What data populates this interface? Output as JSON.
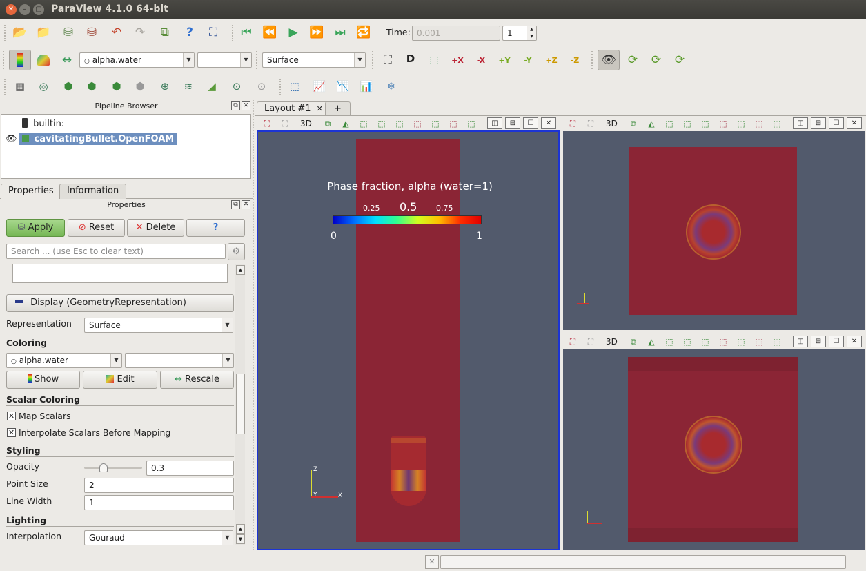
{
  "window": {
    "title": "ParaView 4.1.0 64-bit"
  },
  "toolbar_main": {
    "time_label": "Time:",
    "time_value": "0.001",
    "timestep_value": "1"
  },
  "toolbar_display": {
    "color_array": "alpha.water",
    "color_component": "",
    "representation": "Surface",
    "camera_buttons": [
      "+X",
      "-X",
      "+Y",
      "-Y",
      "+Z",
      "-Z"
    ]
  },
  "pipeline_browser": {
    "title": "Pipeline Browser",
    "items": [
      {
        "label": "builtin:"
      },
      {
        "label": "cavitatingBullet.OpenFOAM",
        "selected": true
      }
    ]
  },
  "panel_tabs": [
    {
      "label": "Properties"
    },
    {
      "label": "Information"
    }
  ],
  "properties": {
    "title": "Properties",
    "apply_label": "Apply",
    "reset_label": "Reset",
    "delete_label": "Delete",
    "help_label": "?",
    "search_placeholder": "Search ... (use Esc to clear text)",
    "display_header": "Display (GeometryRepresentation)",
    "representation_label": "Representation",
    "representation_value": "Surface",
    "coloring_section": "Coloring",
    "coloring_array": "alpha.water",
    "coloring_component": "",
    "show_label": "Show",
    "edit_label": "Edit",
    "rescale_label": "Rescale",
    "scalar_coloring_section": "Scalar Coloring",
    "map_scalars_label": "Map Scalars",
    "map_scalars_checked": true,
    "interpolate_label": "Interpolate Scalars Before Mapping",
    "interpolate_checked": true,
    "styling_section": "Styling",
    "opacity_label": "Opacity",
    "opacity_value": "0.3",
    "opacity_slider_fraction": 0.3,
    "point_size_label": "Point Size",
    "point_size_value": "2",
    "line_width_label": "Line Width",
    "line_width_value": "1",
    "lighting_section": "Lighting",
    "interpolation_label": "Interpolation",
    "interpolation_value": "Gouraud"
  },
  "layout": {
    "tabs": [
      {
        "label": "Layout #1"
      },
      {
        "label": "+"
      }
    ],
    "view_mode_label": "3D"
  },
  "colorbar": {
    "title": "Phase fraction, alpha (water=1)",
    "min_label": "0",
    "max_label": "1",
    "tick_labels": [
      "0.25",
      "0.5",
      "0.75"
    ]
  },
  "axes": {
    "x": "X",
    "y": "Y",
    "z": "Z"
  },
  "colors": {
    "background": "#525a6c",
    "surface_red": "#8b2535",
    "active_border": "#1c34d4",
    "selection": "#6d8fbf",
    "apply_green": "#8fcb6f"
  }
}
